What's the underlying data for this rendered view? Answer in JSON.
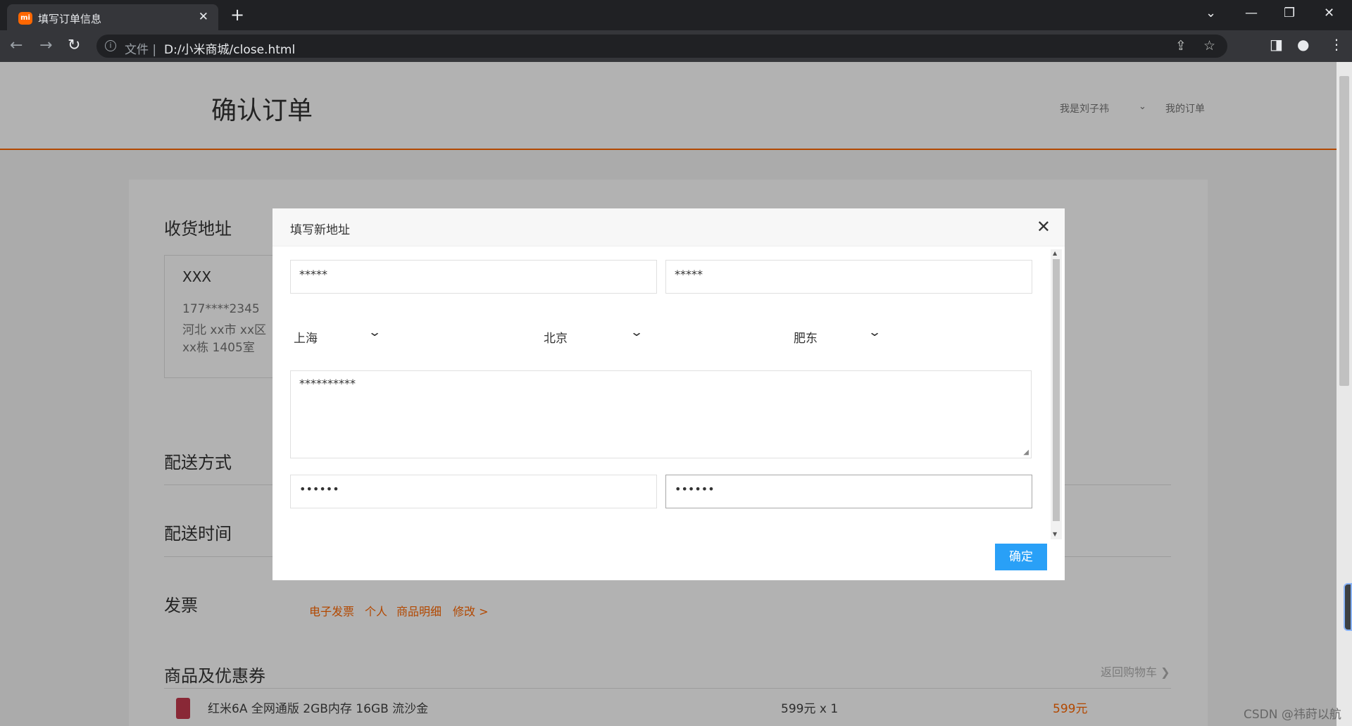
{
  "browser": {
    "tab_title": "填写订单信息",
    "favicon_text": "mi",
    "tab_close": "✕",
    "new_tab": "+",
    "url_scheme": "文件 |",
    "url": "D:/小米商城/close.html",
    "win_dropdown": "⌄",
    "win_minimize": "—",
    "win_restore": "❐",
    "win_close": "✕"
  },
  "header": {
    "title": "确认订单",
    "user": "我是刘子祎",
    "user_chevron": "⌄",
    "my_orders": "我的订单"
  },
  "sections": {
    "address": "收货地址",
    "delivery_method": "配送方式",
    "delivery_time": "配送时间",
    "invoice": "发票",
    "goods": "商品及优惠券"
  },
  "address_card": {
    "name": "XXX",
    "phone": "177****2345",
    "line1": "河北 xx市 xx区",
    "line2": "xx栋 1405室"
  },
  "invoice": {
    "type": "电子发票",
    "who": "个人",
    "detail": "商品明细",
    "edit": "修改 >"
  },
  "back_to_cart": "返回购物车 ❯",
  "product": {
    "name": "红米6A 全网通版 2GB内存 16GB 流沙金",
    "qty": "599元 x 1",
    "total": "599元"
  },
  "modal": {
    "title": "填写新地址",
    "close": "✕",
    "name_value": "*****",
    "phone_value": "*****",
    "province": "上海",
    "city": "北京",
    "district": "肥东",
    "address_value": "**********",
    "field4_value": "••••••",
    "field5_value": "••••••",
    "confirm": "确定"
  },
  "watermark": "CSDN @祎莳以航"
}
